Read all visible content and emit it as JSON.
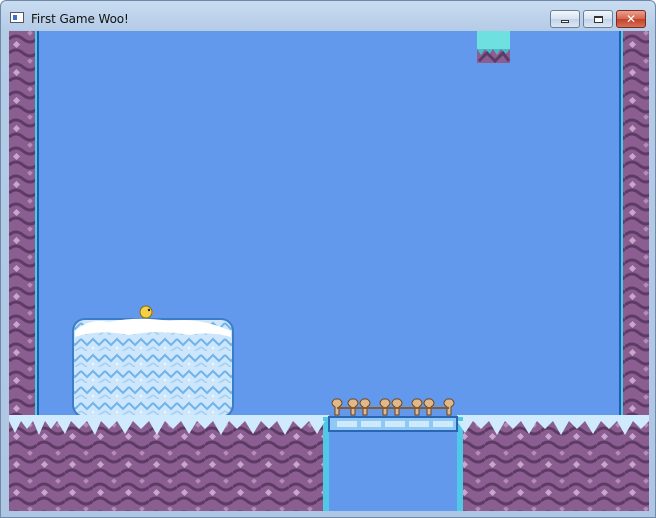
{
  "window": {
    "title": "First Game Woo!",
    "controls": {
      "minimize": "minimize",
      "maximize": "maximize",
      "close": "close"
    }
  },
  "game": {
    "sky_color": "#6399ec",
    "rock_color": "#8a5e90",
    "ice_color": "#cbe4f8",
    "objects": [
      "left-rock-wall",
      "right-rock-wall",
      "ceiling-ice-block",
      "snow-ice-block",
      "player-chick",
      "left-ground",
      "right-ground",
      "ice-bridge",
      "spike-row"
    ]
  }
}
